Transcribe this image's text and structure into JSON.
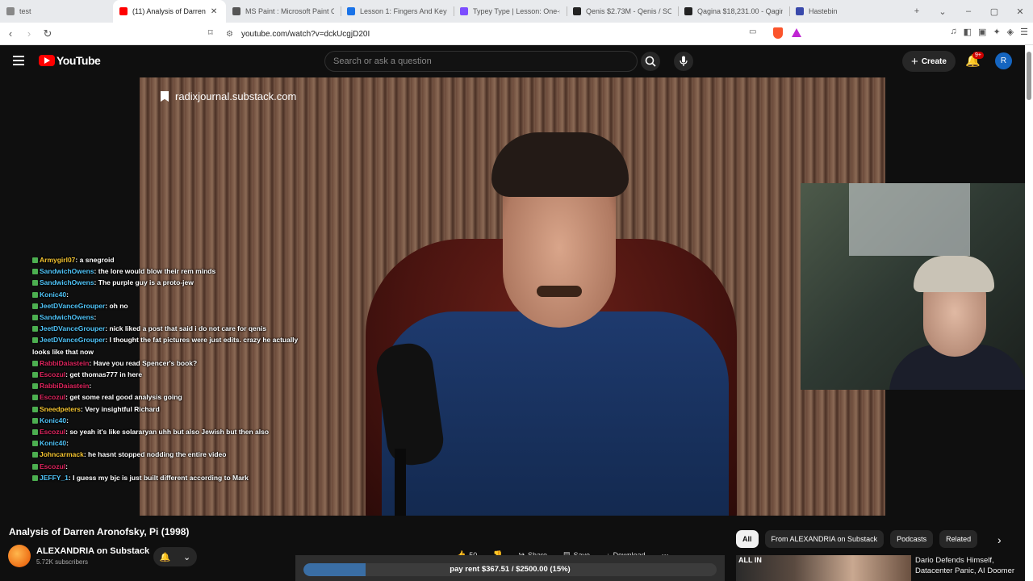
{
  "browser": {
    "tabs": [
      {
        "label": "test",
        "color": "#888888",
        "active": false
      },
      {
        "label": "(11) Analysis of Darren",
        "color": "#ff0000",
        "active": true
      },
      {
        "label": "MS Paint : Microsoft Paint Onl",
        "color": "#555555",
        "active": false
      },
      {
        "label": "Lesson 1: Fingers And Keys - C",
        "color": "#1a73e8",
        "active": false
      },
      {
        "label": "Typey Type | Lesson: One-sylla",
        "color": "#7c4dff",
        "active": false
      },
      {
        "label": "Qenis $2.73M - Qenis / SOL o",
        "color": "#222222",
        "active": false
      },
      {
        "label": "Qagina $18,231.00 - Qagina /",
        "color": "#222222",
        "active": false
      },
      {
        "label": "Hastebin",
        "color": "#3949ab",
        "active": false
      }
    ],
    "url": "youtube.com/watch?v=dckUcgjD20I"
  },
  "yt": {
    "logo_text": "YouTube",
    "search_placeholder": "Search or ask a question",
    "create_label": "Create",
    "notif_badge": "9+",
    "avatar_letter": "R"
  },
  "video": {
    "watermark": "radixjournal.substack.com"
  },
  "chat": [
    {
      "user": "Armygirl07",
      "msg": "a snegroid",
      "color": "#f4c430"
    },
    {
      "user": "SandwichOwens",
      "msg": "the lore would blow their rem minds",
      "color": "#4fc3f7"
    },
    {
      "user": "SandwichOwens",
      "msg": "The purple guy is a proto-jew",
      "color": "#4fc3f7"
    },
    {
      "user": "Konic40",
      "msg": "",
      "color": "#4fc3f7"
    },
    {
      "user": "JeetDVanceGrouper",
      "msg": "oh no",
      "color": "#4fc3f7"
    },
    {
      "user": "SandwichOwens",
      "msg": "",
      "color": "#4fc3f7"
    },
    {
      "user": "JeetDVanceGrouper",
      "msg": "nick liked a post that said i do not care for qenis",
      "color": "#4fc3f7"
    },
    {
      "user": "JeetDVanceGrouper",
      "msg": "I thought the fat pictures were just edits. crazy he actually looks like that now",
      "color": "#4fc3f7"
    },
    {
      "user": "RabbiDaiastein",
      "msg": "Have you read Spencer's book?",
      "color": "#e0245e"
    },
    {
      "user": "Escozul",
      "msg": "get thomas777 in here",
      "color": "#e0245e"
    },
    {
      "user": "RabbiDaiastein",
      "msg": "",
      "color": "#e0245e"
    },
    {
      "user": "Escozul",
      "msg": "get some real good analysis going",
      "color": "#e0245e"
    },
    {
      "user": "Sneedpeters",
      "msg": "Very insightful Richard",
      "color": "#f4c430"
    },
    {
      "user": "Konic40",
      "msg": "",
      "color": "#4fc3f7"
    },
    {
      "user": "Escozul",
      "msg": "so yeah it's like solararyan uhh but also Jewish but then also",
      "color": "#e0245e"
    },
    {
      "user": "Konic40",
      "msg": "",
      "color": "#4fc3f7"
    },
    {
      "user": "Johncarmack",
      "msg": "he hasnt stopped nodding the entire video",
      "color": "#f4c430"
    },
    {
      "user": "Escozul",
      "msg": "",
      "color": "#e0245e"
    },
    {
      "user": "JEFFY_1",
      "msg": "I guess my bjc is just built different according to Mark",
      "color": "#4fc3f7"
    }
  ],
  "below": {
    "title": "Analysis of Darren Aronofsky, Pi (1998)",
    "channel": "ALEXANDRIA on Substack",
    "subs": "5.72K subscribers",
    "likes": "50",
    "share": "Share",
    "save": "Save",
    "download": "Download"
  },
  "donation": {
    "label": "pay rent $367.51 / $2500.00 (15%)",
    "progress": 0.15
  },
  "filters": [
    "All",
    "From ALEXANDRIA on Substack",
    "Podcasts",
    "Related"
  ],
  "recommend": {
    "thumb_text": "ALL IN",
    "title": "Dario Defends Himself, Datacenter Panic, AI Doomer"
  }
}
